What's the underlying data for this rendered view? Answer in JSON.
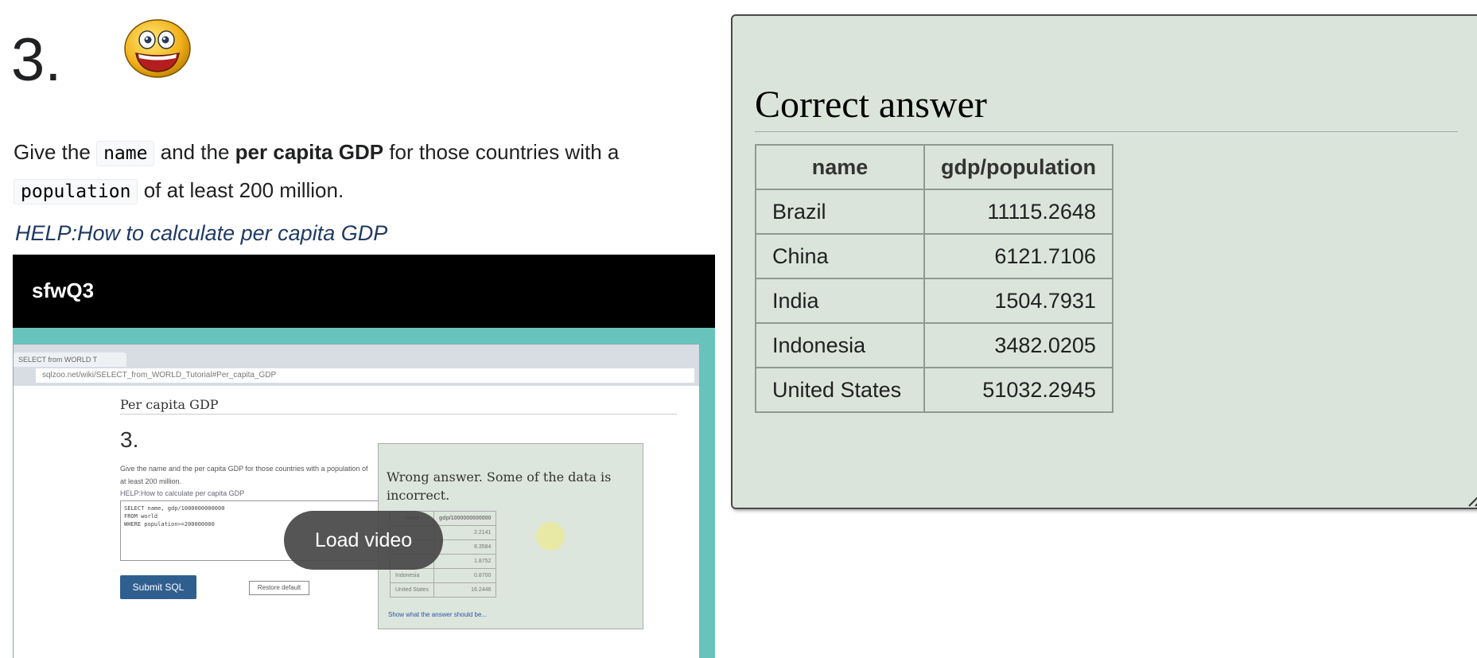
{
  "question": {
    "number": "3.",
    "prompt_text_1": "Give the",
    "prompt_code_1": "name",
    "prompt_text_2": "and the",
    "prompt_bold": "per capita GDP",
    "prompt_text_3": "for those countries with a",
    "prompt_code_2": "population",
    "prompt_text_4": "of at least 200 million."
  },
  "help_link": "HELP:How to calculate per capita GDP",
  "video": {
    "title": "sfwQ3",
    "load_label": "Load video",
    "browser_tab": "SELECT from WORLD T",
    "browser_url": "sqlzoo.net/wiki/SELECT_from_WORLD_Tutorial#Per_capita_GDP",
    "page_heading": "Per capita GDP",
    "page_number": "3.",
    "page_prompt": "Give the name and the per capita GDP for those countries with a population of at least 200 million.",
    "page_help": "HELP:How to calculate per capita GDP",
    "page_code": "SELECT name, gdp/1000000000000\nFROM world\nWHERE population>=200000000",
    "submit_label": "Submit SQL",
    "restore_label": "Restore default",
    "result_title": "Wrong answer. Some of the data is incorrect.",
    "result_columns": [
      "name",
      "gdp/1000000000000"
    ],
    "result_rows": [
      [
        "",
        "2.2141"
      ],
      [
        "",
        "8.3584"
      ],
      [
        "",
        "1.8752"
      ],
      [
        "Indonesia",
        "0.8700"
      ],
      [
        "United States",
        "16.2446"
      ]
    ],
    "show_answer_link": "Show what the answer should be..."
  },
  "answer": {
    "heading": "Correct answer",
    "columns": [
      "name",
      "gdp/population"
    ],
    "rows": [
      {
        "name": "Brazil",
        "value": "11115.2648"
      },
      {
        "name": "China",
        "value": "6121.7106"
      },
      {
        "name": "India",
        "value": "1504.7931"
      },
      {
        "name": "Indonesia",
        "value": "3482.0205"
      },
      {
        "name": "United States",
        "value": "51032.2945"
      }
    ]
  },
  "icons": {
    "smiley": "smiley-face-icon",
    "resize": "resize-grip-icon"
  },
  "colors": {
    "panel_bg": "#dbe4da",
    "link": "#1f3a63",
    "video_bg": "#68c3bd"
  }
}
